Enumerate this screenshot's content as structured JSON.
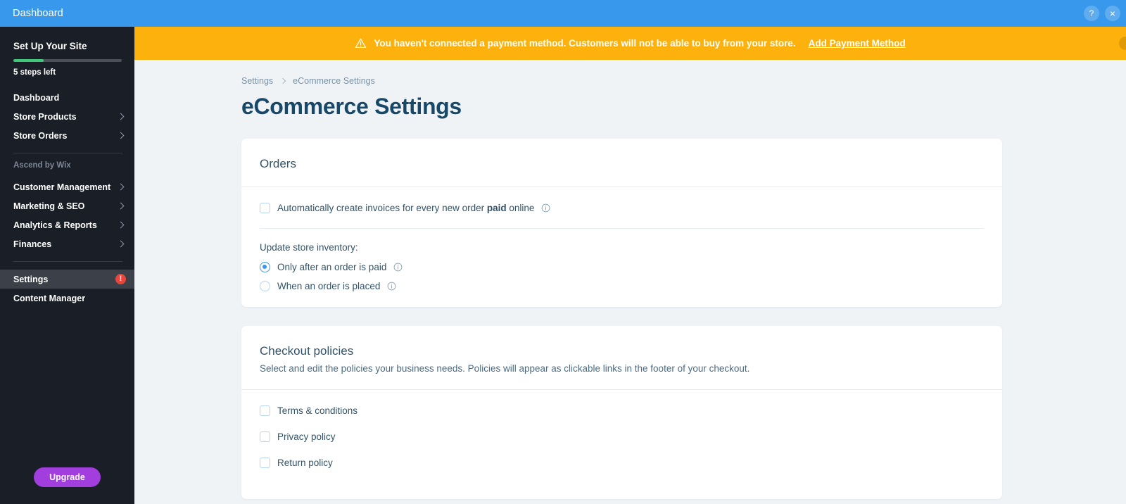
{
  "topbar": {
    "title": "Dashboard",
    "help_label": "?",
    "close_label": "×"
  },
  "sidebar": {
    "setup": {
      "title": "Set Up Your Site",
      "steps_left": "5 steps left",
      "progress_percent": 28
    },
    "items": [
      {
        "label": "Dashboard",
        "chevron": false,
        "active": false,
        "badge": null
      },
      {
        "label": "Store Products",
        "chevron": true,
        "active": false,
        "badge": null
      },
      {
        "label": "Store Orders",
        "chevron": true,
        "active": false,
        "badge": null
      }
    ],
    "group_label": "Ascend by Wix",
    "group_items": [
      {
        "label": "Customer Management",
        "chevron": true,
        "active": false,
        "badge": null
      },
      {
        "label": "Marketing & SEO",
        "chevron": true,
        "active": false,
        "badge": null
      },
      {
        "label": "Analytics & Reports",
        "chevron": true,
        "active": false,
        "badge": null
      },
      {
        "label": "Finances",
        "chevron": true,
        "active": false,
        "badge": null
      }
    ],
    "bottom_items": [
      {
        "label": "Settings",
        "chevron": false,
        "active": true,
        "badge": "!"
      },
      {
        "label": "Content Manager",
        "chevron": false,
        "active": false,
        "badge": null
      }
    ],
    "upgrade_label": "Upgrade"
  },
  "banner": {
    "message": "You haven't connected a payment method. Customers will not be able to buy from your store.",
    "link_label": "Add Payment Method",
    "icon": "warning-triangle-icon",
    "background_color": "#FDB10C"
  },
  "breadcrumb": {
    "parent": "Settings",
    "current": "eCommerce Settings"
  },
  "page": {
    "title": "eCommerce Settings"
  },
  "orders_card": {
    "title": "Orders",
    "invoice_option": {
      "text_before": "Automatically create invoices for every new order ",
      "text_bold": "paid",
      "text_after": " online",
      "checked": false
    },
    "inventory_label": "Update store inventory:",
    "inventory_options": [
      {
        "label": "Only after an order is paid",
        "selected": true
      },
      {
        "label": "When an order is placed",
        "selected": false
      }
    ]
  },
  "checkout_card": {
    "title": "Checkout policies",
    "subtitle": "Select and edit the policies your business needs. Policies will appear as clickable links in the footer of your checkout.",
    "policies": [
      {
        "label": "Terms & conditions",
        "checked": false
      },
      {
        "label": "Privacy policy",
        "checked": false
      },
      {
        "label": "Return policy",
        "checked": false
      }
    ]
  },
  "colors": {
    "accent_blue": "#3899EC",
    "warning_orange": "#FDB10C",
    "sidebar_dark": "#1A1E26",
    "page_bg": "#EFF3F6",
    "title_navy": "#174868",
    "upgrade_purple": "#A23EDD",
    "progress_green": "#3FC77A",
    "alert_red": "#E8453C"
  }
}
